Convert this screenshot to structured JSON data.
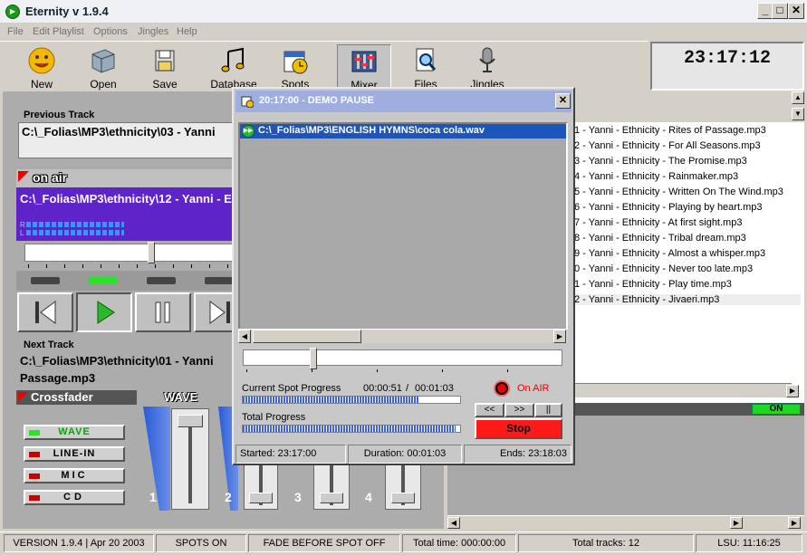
{
  "window": {
    "title": "Eternity v 1.9.4",
    "app_icon": "play-circle-icon",
    "min": "_",
    "max": "□",
    "close": "✕"
  },
  "menu": [
    "File",
    "Edit Playlist",
    "Options",
    "Jingles",
    "Help"
  ],
  "toolbar": {
    "new": "New",
    "open": "Open",
    "save": "Save",
    "database": "Database",
    "spots": "Spots",
    "mixer": "Mixer",
    "files": "Files",
    "jingles": "Jingles"
  },
  "clock": "23:17:12",
  "previous": {
    "label": "Previous Track",
    "path": "C:\\_Folias\\MP3\\ethnicity\\03 - Yanni"
  },
  "onair": {
    "label": "on air",
    "path": "C:\\_Folias\\MP3\\ethnicity\\12 - Yanni - E",
    "meter_r": "R",
    "meter_l": "L"
  },
  "next": {
    "label": "Next Track",
    "path": "C:\\_Folias\\MP3\\ethnicity\\01 - Yanni",
    "path2": "Passage.mp3"
  },
  "crossfader": {
    "label": "Crossfader",
    "wave_hdr": "WAVE",
    "sources": [
      "WAVE",
      "LINE-IN",
      "MIC",
      "CD"
    ],
    "faders": [
      "1",
      "2",
      "3",
      "4"
    ]
  },
  "playlist": [
    "1 - Yanni - Ethnicity - Rites of Passage.mp3",
    "2 - Yanni - Ethnicity - For All Seasons.mp3",
    "3 - Yanni - Ethnicity - The Promise.mp3",
    "4 - Yanni - Ethnicity - Rainmaker.mp3",
    "5 - Yanni - Ethnicity - Written On The Wind.mp3",
    "6 - Yanni - Ethnicity - Playing by heart.mp3",
    "7 - Yanni - Ethnicity - At first sight.mp3",
    "8 - Yanni - Ethnicity - Tribal dream.mp3",
    "9 - Yanni - Ethnicity - Almost a whisper.mp3",
    "0 - Yanni - Ethnicity - Never too late.mp3",
    "1 - Yanni - Ethnicity - Play time.mp3",
    "2 - Yanni - Ethnicity - Jivaeri.mp3"
  ],
  "right_on": "ON",
  "dialog": {
    "title": "20:17:00 - DEMO PAUSE",
    "item": "C:\\_Folias\\MP3\\ENGLISH HYMNS\\coca cola.wav",
    "current_label": "Current Spot Progress",
    "current_time": "00:00:51",
    "slash": "/",
    "current_total": "00:01:03",
    "onair": "On AIR",
    "total_label": "Total Progress",
    "btn_rew": "<<",
    "btn_ff": ">>",
    "btn_pause": "||",
    "btn_stop": "Stop",
    "started": "Started: 23:17:00",
    "duration": "Duration: 00:01:03",
    "ends": "Ends: 23:18:03",
    "current_progress": 0.81,
    "total_progress": 0.98
  },
  "status": {
    "version": "VERSION 1.9.4 | Apr  20 2003",
    "spots": "SPOTS ON",
    "fade": "FADE BEFORE SPOT OFF",
    "total_time": "Total time: 000:00:00",
    "total_tracks": "Total tracks: 12",
    "lsu": "LSU: 11:16:25"
  },
  "colors": {
    "onair_panel": "#5f24c9",
    "stop": "#ff1a1a",
    "selection": "#1f54b8"
  }
}
